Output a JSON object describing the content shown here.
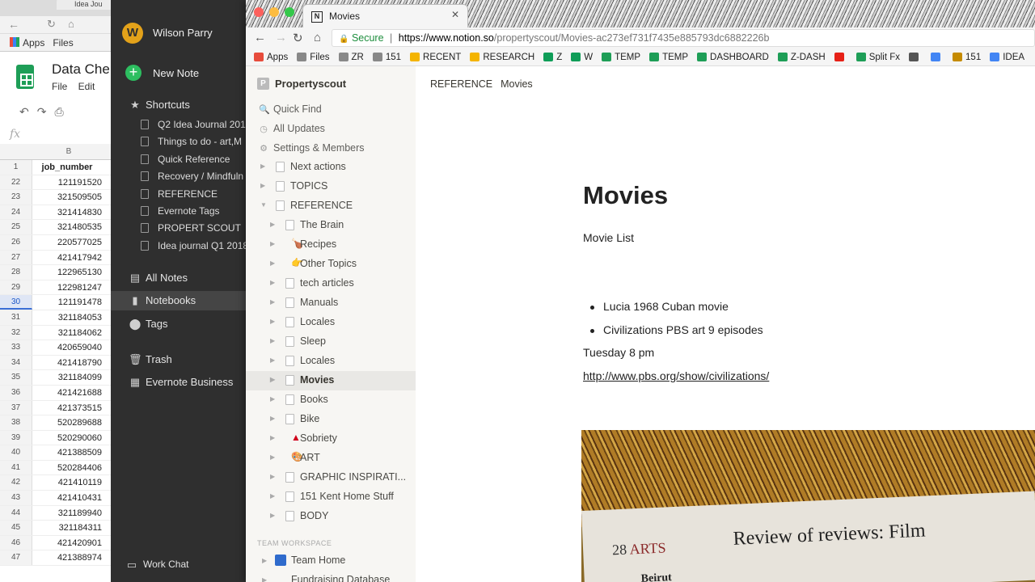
{
  "sheets": {
    "tab_label": "Idea Jou",
    "bookmarks_label": "Apps   Files",
    "title": "Data Che",
    "menu": "File Edit",
    "toolbar_icons": "↶↷⎙",
    "fx": "fx",
    "column": "B",
    "rows": [
      {
        "n": "1",
        "v": "job_number",
        "header": true
      },
      {
        "n": "22",
        "v": "121191520"
      },
      {
        "n": "23",
        "v": "321509505"
      },
      {
        "n": "24",
        "v": "321414830"
      },
      {
        "n": "25",
        "v": "321480535"
      },
      {
        "n": "26",
        "v": "220577025"
      },
      {
        "n": "27",
        "v": "421417942"
      },
      {
        "n": "28",
        "v": "122965130"
      },
      {
        "n": "29",
        "v": "122981247"
      },
      {
        "n": "30",
        "v": "121191478",
        "selected": true
      },
      {
        "n": "31",
        "v": "321184053"
      },
      {
        "n": "32",
        "v": "321184062"
      },
      {
        "n": "33",
        "v": "420659040"
      },
      {
        "n": "34",
        "v": "421418790"
      },
      {
        "n": "35",
        "v": "321184099"
      },
      {
        "n": "36",
        "v": "421421688"
      },
      {
        "n": "37",
        "v": "421373515"
      },
      {
        "n": "38",
        "v": "520289688"
      },
      {
        "n": "39",
        "v": "520290060"
      },
      {
        "n": "40",
        "v": "421388509"
      },
      {
        "n": "41",
        "v": "520284406"
      },
      {
        "n": "42",
        "v": "421410119"
      },
      {
        "n": "43",
        "v": "421410431"
      },
      {
        "n": "44",
        "v": "321189940"
      },
      {
        "n": "45",
        "v": "321184311"
      },
      {
        "n": "46",
        "v": "421420901"
      },
      {
        "n": "47",
        "v": "421388974"
      }
    ]
  },
  "evernote": {
    "user": "Wilson Parry",
    "avatar_letter": "W",
    "new_note": "New Note",
    "shortcuts": "Shortcuts",
    "shortcut_items": [
      "Q2 Idea Journal 201",
      "Things to do - art,M",
      "Quick Reference",
      "Recovery / Mindfuln",
      "REFERENCE",
      "Evernote Tags",
      "PROPERT SCOUT",
      "Idea journal Q1 2018"
    ],
    "all_notes": "All Notes",
    "notebooks": "Notebooks",
    "tags": "Tags",
    "trash": "Trash",
    "business": "Evernote Business",
    "work_chat": "Work Chat"
  },
  "browser": {
    "tab_title": "Movies",
    "tab_icon": "N",
    "url_secure": "Secure",
    "url_host": "https://www.notion.so",
    "url_path": "/propertyscout/Movies-ac273ef731f7435e885793dc6882226b",
    "bookmarks": [
      {
        "label": "Apps",
        "color": "#e74c3c"
      },
      {
        "label": "Files",
        "color": "#888888"
      },
      {
        "label": "ZR",
        "color": "#888888"
      },
      {
        "label": "151",
        "color": "#888888"
      },
      {
        "label": "RECENT",
        "color": "#f4b400"
      },
      {
        "label": "RESEARCH",
        "color": "#f4b400"
      },
      {
        "label": "Z",
        "color": "#0f9d58"
      },
      {
        "label": "W",
        "color": "#0f9d58"
      },
      {
        "label": "TEMP",
        "color": "#1e9e57"
      },
      {
        "label": "TEMP",
        "color": "#1e9e57"
      },
      {
        "label": "DASHBOARD",
        "color": "#1e9e57"
      },
      {
        "label": "Z-DASH",
        "color": "#1e9e57"
      },
      {
        "label": "",
        "color": "#e62117"
      },
      {
        "label": "Split Fx",
        "color": "#1e9e57"
      },
      {
        "label": "",
        "color": "#555555"
      },
      {
        "label": "",
        "color": "#4285f4"
      },
      {
        "label": "151",
        "color": "#c58b00"
      },
      {
        "label": "IDEA",
        "color": "#4285f4"
      }
    ]
  },
  "notion": {
    "workspace": "Propertyscout",
    "workspace_initial": "P",
    "quick_find": "Quick Find",
    "all_updates": "All Updates",
    "settings": "Settings & Members",
    "pages": [
      {
        "label": "Next actions",
        "level": 1,
        "emoji": ""
      },
      {
        "label": "TOPICS",
        "level": 1,
        "emoji": ""
      },
      {
        "label": "REFERENCE",
        "level": 1,
        "emoji": "",
        "open": true
      },
      {
        "label": "The Brain",
        "level": 2,
        "emoji": ""
      },
      {
        "label": "Recipes",
        "level": 2,
        "emoji": "🍗"
      },
      {
        "label": "Other Topics",
        "level": 2,
        "emoji": "👉"
      },
      {
        "label": "tech articles",
        "level": 2,
        "emoji": ""
      },
      {
        "label": "Manuals",
        "level": 2,
        "emoji": ""
      },
      {
        "label": "Locales",
        "level": 2,
        "emoji": ""
      },
      {
        "label": "Sleep",
        "level": 2,
        "emoji": ""
      },
      {
        "label": "Locales",
        "level": 2,
        "emoji": ""
      },
      {
        "label": "Movies",
        "level": 2,
        "emoji": "",
        "selected": true
      },
      {
        "label": "Books",
        "level": 2,
        "emoji": ""
      },
      {
        "label": "Bike",
        "level": 2,
        "emoji": ""
      },
      {
        "label": "Sobriety",
        "level": 2,
        "emoji": "▲"
      },
      {
        "label": "ART",
        "level": 2,
        "emoji": "🎨"
      },
      {
        "label": "GRAPHIC INSPIRATI...",
        "level": 2,
        "emoji": ""
      },
      {
        "label": "151 Kent Home Stuff",
        "level": 2,
        "emoji": ""
      },
      {
        "label": "BODY",
        "level": 2,
        "emoji": ""
      }
    ],
    "private_label": "TEAM WORKSPACE",
    "team_home": "Team Home",
    "fundraising": "Fundraising Database",
    "breadcrumb": [
      "REFERENCE",
      "Movies"
    ],
    "title": "Movies",
    "subtitle": "Movie List",
    "bullets": [
      "Lucia 1968 Cuban movie",
      "Civilizations PBS art 9 episodes"
    ],
    "tuesday": "Tuesday 8 pm",
    "link": "http://www.pbs.org/show/civilizations/",
    "image": {
      "page_number": "28",
      "section": "ARTS",
      "headline": "Review of reviews: Film",
      "subhead": "Beirut"
    }
  }
}
